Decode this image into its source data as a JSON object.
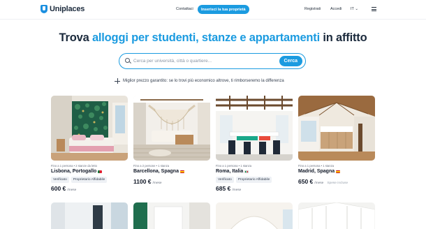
{
  "nav": {
    "logo": "Uniplaces",
    "links": [
      "Contattaci",
      "Registrati",
      "Accedi"
    ],
    "cta": "Inserisci la tua proprietà",
    "language": "IT"
  },
  "hero": {
    "title_before": "Trova ",
    "title_highlight": "alloggi per studenti, stanze e appartamenti",
    "title_after": " in affitto",
    "search_placeholder": "Cerca per università, città o quartiere...",
    "search_button": "Cerca",
    "guarantee": "Miglior prezzo garantito: se lo trovi più economico altrove, ti rimborseremo la differenza"
  },
  "listings": [
    {
      "subtitle": "Fino a 1 persona • 2 stanze da letto",
      "city": "Lisbona, Portogallo",
      "flag_colors": [
        "#0b7a3a",
        "#e11d2e"
      ],
      "badges": [
        "Verificato",
        "Proprietario Affidabile"
      ],
      "price": "600 €",
      "per": "/mese",
      "extra": ""
    },
    {
      "subtitle": "Fino a 2 persone • 1 stanza",
      "city": "Barcellona, Spagna",
      "flag_colors": [
        "#c60b1e",
        "#ffc400"
      ],
      "badges": [],
      "price": "1100 €",
      "per": "/mese",
      "extra": ""
    },
    {
      "subtitle": "Fino a 1 persona • 1 stanza",
      "city": "Roma, Italia",
      "flag_colors": [
        "#009246",
        "#ce2b37"
      ],
      "badges": [
        "Verificato",
        "Proprietario Affidabile"
      ],
      "price": "685 €",
      "per": "/mese",
      "extra": ""
    },
    {
      "subtitle": "Fino a 1 persona • 1 stanza",
      "city": "Madrid, Spagna",
      "flag_colors": [
        "#c60b1e",
        "#ffc400"
      ],
      "badges": [],
      "price": "650 €",
      "per": "/mese",
      "extra": "Spese incluse"
    }
  ],
  "colors": {
    "accent": "#1b9be0",
    "text": "#1b2a3c"
  }
}
